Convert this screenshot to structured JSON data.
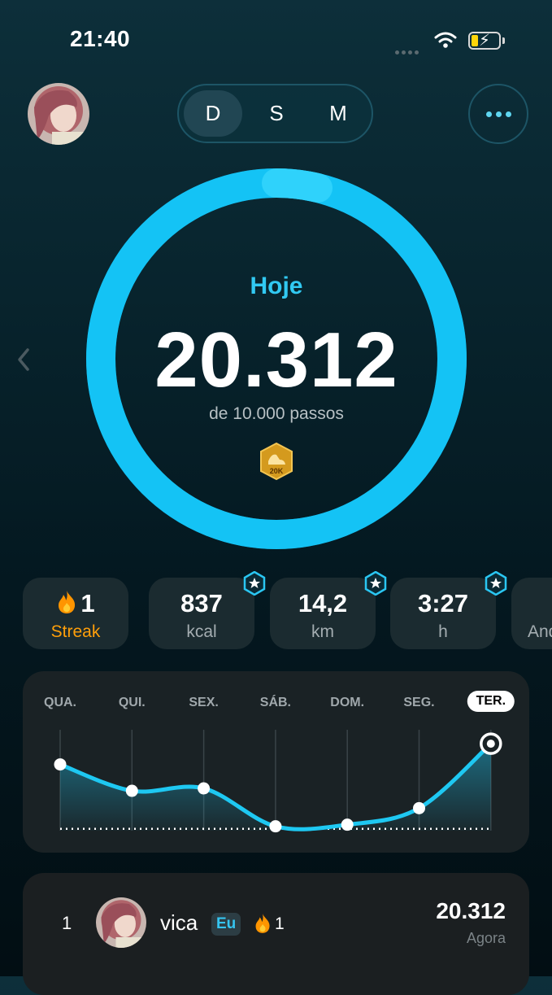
{
  "status_bar": {
    "time": "21:40"
  },
  "header": {
    "segments": [
      {
        "label": "D",
        "active": true
      },
      {
        "label": "S",
        "active": false
      },
      {
        "label": "M",
        "active": false
      }
    ],
    "more_icon": "ellipsis-icon"
  },
  "ring": {
    "period_label": "Hoje",
    "steps": "20.312",
    "goal_text": "de 10.000 passos",
    "progress_fraction": 1.0,
    "badge_text": "20K",
    "ring_color": "#14c3f5"
  },
  "stats": [
    {
      "value": "1",
      "label": "Streak",
      "icon": "flame-icon",
      "accent": "#ff9f0a"
    },
    {
      "value": "837",
      "label": "kcal",
      "star": true
    },
    {
      "value": "14,2",
      "label": "km",
      "star": true
    },
    {
      "value": "3:27",
      "label": "h",
      "star": true
    },
    {
      "value": "",
      "label": "And"
    }
  ],
  "chart": {
    "days": [
      "QUA.",
      "QUI.",
      "SEX.",
      "SÁB.",
      "DOM.",
      "SEG.",
      "TER."
    ],
    "active_day": "TER."
  },
  "chart_data": {
    "type": "line",
    "categories": [
      "QUA.",
      "QUI.",
      "SEX.",
      "SÁB.",
      "DOM.",
      "SEG.",
      "TER."
    ],
    "series": [
      {
        "values": [
          17800,
          14600,
          14900,
          10300,
          10500,
          12500,
          20312
        ]
      }
    ],
    "goal": 10000
  },
  "leaderboard": {
    "rows": [
      {
        "rank": "1",
        "name": "vica",
        "tag": "Eu",
        "streak": "1",
        "steps": "20.312",
        "when": "Agora"
      }
    ]
  }
}
